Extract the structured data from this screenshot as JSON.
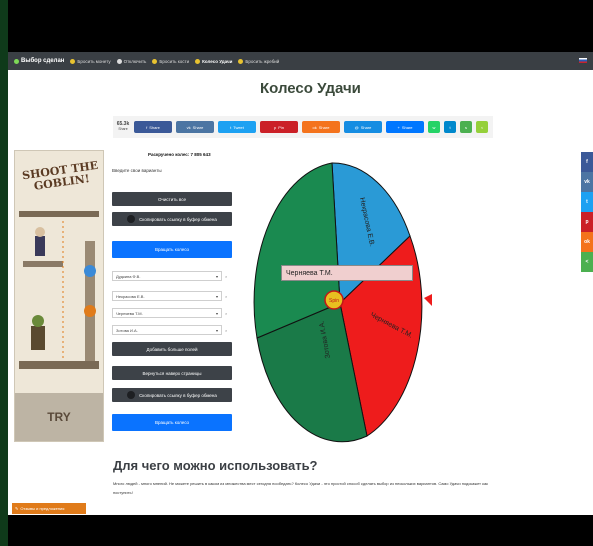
{
  "navbar": {
    "brand": "Выбор сделан",
    "items": [
      {
        "label": "Бросить монету",
        "active": false
      },
      {
        "label": "Отключить",
        "active": false
      },
      {
        "label": "Бросить кости",
        "active": false
      },
      {
        "label": "Колесо Удачи",
        "active": true
      },
      {
        "label": "Бросить жребий",
        "active": false
      }
    ]
  },
  "page": {
    "title": "Колесо Удачи"
  },
  "share": {
    "count": "65.3k",
    "count_label": "Share",
    "buttons": [
      {
        "label": "Share",
        "color": "#3b5998",
        "icon": "facebook-icon"
      },
      {
        "label": "Share",
        "color": "#4c75a3",
        "icon": "vk-icon"
      },
      {
        "label": "Tweet",
        "color": "#1da1f2",
        "icon": "twitter-icon"
      },
      {
        "label": "Pin",
        "color": "#cb2027",
        "icon": "pinterest-icon"
      },
      {
        "label": "Share",
        "color": "#f4731c",
        "icon": "odnoklassniki-icon"
      },
      {
        "label": "Share",
        "color": "#168de2",
        "icon": "mail-icon"
      },
      {
        "label": "Share",
        "color": "#0077ff",
        "icon": "share-icon"
      },
      {
        "label": "",
        "color": "#25d366",
        "icon": "whatsapp-icon"
      },
      {
        "label": "",
        "color": "#0088cc",
        "icon": "telegram-icon"
      },
      {
        "label": "",
        "color": "#4cb050",
        "icon": "sms-icon"
      },
      {
        "label": "",
        "color": "#95d03a",
        "icon": "share-more-icon"
      }
    ]
  },
  "ad": {
    "title": "SHOOT THE GOBLIN!",
    "cta": "TRY"
  },
  "panel": {
    "counter": "Раскручено колес: 7 805 643",
    "hint": "Введите свои варианты",
    "clear_button": "Очистить все",
    "copy_link_button": "Скопировать ссылку в буфер обмена",
    "spin_button": "Вращать колесо",
    "items": [
      "Дудкина Ф.В.",
      "Некрасова Е.В.",
      "Черняева Т.М.",
      "Зотова И.А."
    ],
    "add_more_button": "Добавить больше полей",
    "back_to_top_button": "Вернуться наверх страницы",
    "copy_link_button_2": "Скопировать ссылку в буфер обмена",
    "spin_button_2": "Вращать колесо"
  },
  "wheel": {
    "segments": [
      {
        "label": "Некрасова Е.В.",
        "color": "#2a9ad6"
      },
      {
        "label": "Черняева Т.М.",
        "color": "#ee1c1c"
      },
      {
        "label": "Зотова И.А.",
        "color": "#1a7a48"
      },
      {
        "label": "Дудкина Ф.В.",
        "color": "#1a8a50"
      }
    ],
    "center_label": "Spin",
    "winner": "Черняева Т.М."
  },
  "side_share": [
    {
      "label": "f",
      "color": "#3b5998"
    },
    {
      "label": "vk",
      "color": "#4c75a3"
    },
    {
      "label": "t",
      "color": "#1da1f2"
    },
    {
      "label": "p",
      "color": "#cb2027"
    },
    {
      "label": "ok",
      "color": "#f4731c"
    },
    {
      "label": "<",
      "color": "#4cb050"
    }
  ],
  "section": {
    "heading": "Для чего можно использовать?",
    "text": "Много людей - много мнений. Не можете решить в каком из множества мест сегодня пообедать? Колесо Удачи - это простой способ сделать выбор из нескольких вариантов. Само Удачи подскажет как поступить!"
  },
  "feedback": {
    "label": "Отзывы и предложения"
  }
}
